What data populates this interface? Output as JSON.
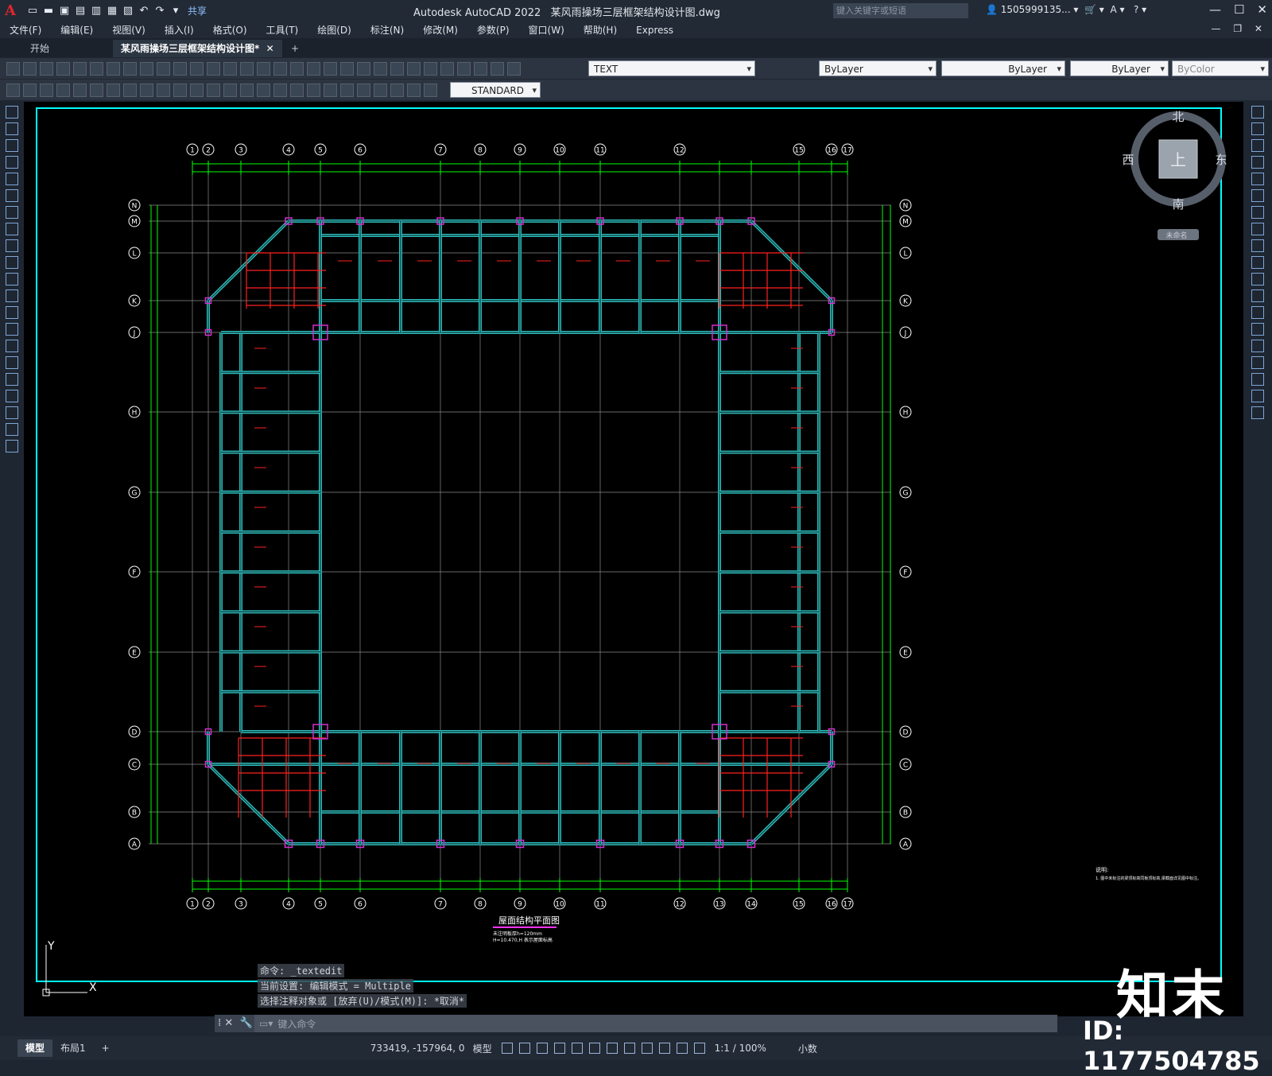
{
  "app": {
    "title": "Autodesk AutoCAD 2022",
    "file_title": "某风雨操场三层框架结构设计图.dwg",
    "share": "共享",
    "search_placeholder": "键入关键字或短语",
    "user": "1505999135...",
    "help_icon": "?"
  },
  "menu": [
    "文件(F)",
    "编辑(E)",
    "视图(V)",
    "插入(I)",
    "格式(O)",
    "工具(T)",
    "绘图(D)",
    "标注(N)",
    "修改(M)",
    "参数(P)",
    "窗口(W)",
    "帮助(H)",
    "Express"
  ],
  "tabs": [
    {
      "label": "开始"
    },
    {
      "label": "某风雨操场三层框架结构设计图*"
    }
  ],
  "toolbar": {
    "text_style": "TEXT",
    "dim_style": "STANDARD",
    "layer_color": "ByLayer",
    "linetype": "ByLayer",
    "lineweight": "ByLayer",
    "plot_style": "ByColor"
  },
  "viewcube": {
    "north": "北",
    "south": "南",
    "east": "东",
    "west": "西",
    "top": "上",
    "ucs": "未命名"
  },
  "drawing": {
    "col_axes": [
      "1",
      "2",
      "3",
      "4",
      "5",
      "6",
      "7",
      "8",
      "9",
      "10",
      "11",
      "12",
      "15",
      "16",
      "17"
    ],
    "col_axes_bottom": [
      "1",
      "2",
      "3",
      "4",
      "5",
      "6",
      "7",
      "8",
      "9",
      "10",
      "11",
      "12",
      "13",
      "14",
      "15",
      "16",
      "17"
    ],
    "row_axes": [
      "N",
      "M",
      "L",
      "K",
      "J",
      "H",
      "G",
      "F",
      "E",
      "D",
      "C",
      "B",
      "A"
    ],
    "plan_title": "屋面结构平面图",
    "plan_note1": "未注明板厚h=120mm",
    "plan_note2": "H=10.470,H 表示屋面标高",
    "notes_title": "说明:",
    "notes_line": "1. 图中未标注的梁顶标高同板顶标高,梁截面详见图中标注。"
  },
  "command": {
    "line1": "命令: _textedit",
    "line2": "当前设置: 编辑模式 = Multiple",
    "line3": "选择注释对象或 [放弃(U)/模式(M)]: *取消*",
    "prompt": "键入命令"
  },
  "status": {
    "tab_model": "模型",
    "tab_layout": "布局1",
    "coords": "733419, -157964, 0",
    "space": "模型",
    "scale": "1:1 / 100%",
    "units": "小数"
  },
  "watermark": {
    "brand": "知末",
    "id": "ID: 1177504785"
  }
}
